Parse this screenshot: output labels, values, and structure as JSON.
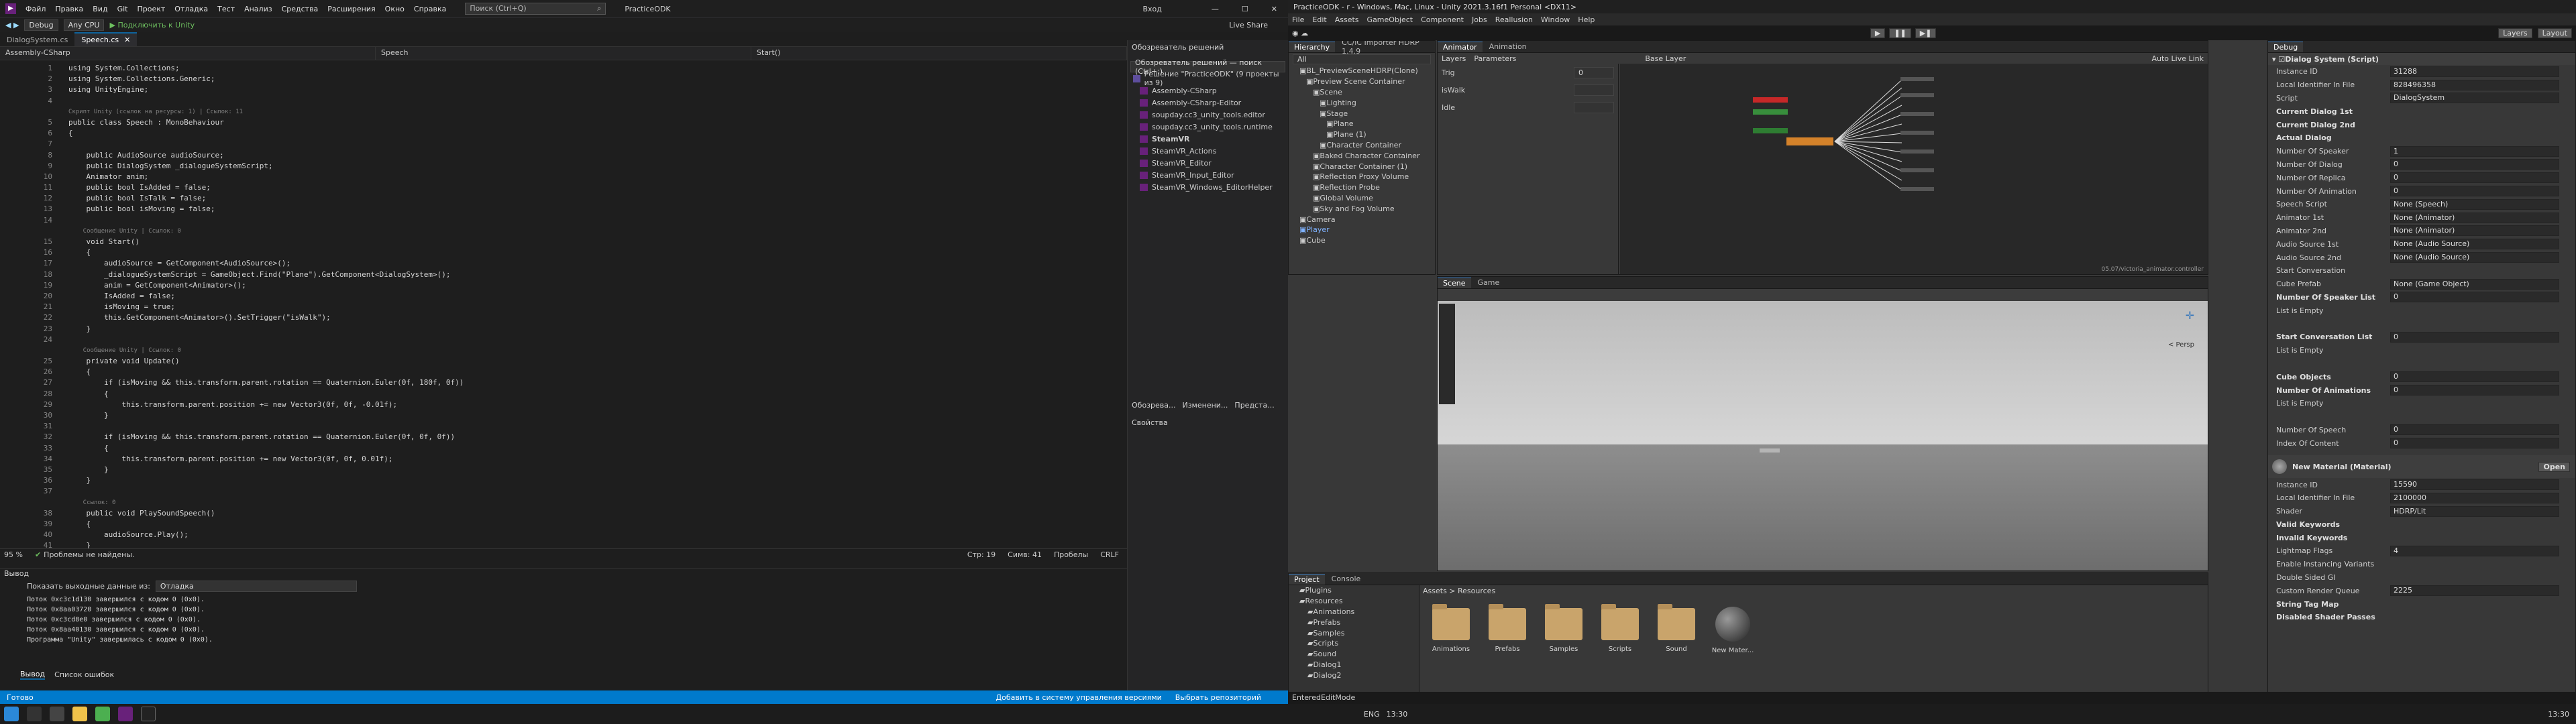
{
  "vs": {
    "title": "PracticeODK",
    "menu": [
      "Файл",
      "Правка",
      "Вид",
      "Git",
      "Проект",
      "Отладка",
      "Тест",
      "Анализ",
      "Средства",
      "Расширения",
      "Окно",
      "Справка"
    ],
    "search_placeholder": "Поиск (Ctrl+Q)",
    "config": "Debug",
    "platform": "Any CPU",
    "attach": "Подключить к Unity",
    "user": "Вход",
    "live_share": "Live Share",
    "tabs": [
      "DialogSystem.cs",
      "Speech.cs"
    ],
    "nav": [
      "Assembly-CSharp",
      "Speech",
      "Start()"
    ],
    "status": {
      "zoom": "95 %",
      "problems": "Проблемы не найдены.",
      "line": "Стр: 19",
      "col": "Симв: 41",
      "spaces": "Пробелы",
      "eol": "CRLF"
    },
    "output_title": "Вывод",
    "output_source_label": "Показать выходные данные из:",
    "output_source": "Отладка",
    "output_lines": [
      "Поток 0xc3c1d130 завершился с кодом 0 (0x0).",
      "Поток 0x8aa03720 завершился с кодом 0 (0x0).",
      "Поток 0xc3cd8e0 завершился с кодом 0 (0x0).",
      "Поток 0x8aa40130 завершился с кодом 0 (0x0).",
      "Программа \"Unity\" завершилась с кодом 0 (0x0)."
    ],
    "bottom_tabs": [
      "Вывод",
      "Список ошибок"
    ],
    "ready": "Готово",
    "add_vcs": "Добавить в систему управления версиями",
    "select_repo": "Выбрать репозиторий",
    "solution_title": "Обозреватель решений",
    "solution_search": "Обозреватель решений — поиск (Ctrl+;)",
    "solution_root": "Решение \"PracticeODK\" (9 проекты из 9)",
    "solution_items": [
      "Assembly-CSharp",
      "Assembly-CSharp-Editor",
      "soupday.cc3_unity_tools.editor",
      "soupday.cc3_unity_tools.runtime",
      "SteamVR",
      "SteamVR_Actions",
      "SteamVR_Editor",
      "SteamVR_Input_Editor",
      "SteamVR_Windows_EditorHelper"
    ],
    "sol_tabs": [
      "Обозрева...",
      "Изменени...",
      "Предста..."
    ],
    "props_title": "Свойства",
    "side_tabs": [
      "Источники данных"
    ]
  },
  "code": [
    {
      "n": "1",
      "t": "using System.Collections;"
    },
    {
      "n": "2",
      "t": "using System.Collections.Generic;"
    },
    {
      "n": "3",
      "t": "using UnityEngine;"
    },
    {
      "n": "4",
      "t": ""
    },
    {
      "n": "",
      "t": "Скрипт Unity (ссылок на ресурсы: 1) | Ссылок: 11",
      "c": true
    },
    {
      "n": "5",
      "t": "public class Speech : MonoBehaviour"
    },
    {
      "n": "6",
      "t": "{"
    },
    {
      "n": "7",
      "t": ""
    },
    {
      "n": "8",
      "t": "    public AudioSource audioSource;"
    },
    {
      "n": "9",
      "t": "    public DialogSystem _dialogueSystemScript;"
    },
    {
      "n": "10",
      "t": "    Animator anim;"
    },
    {
      "n": "11",
      "t": "    public bool IsAdded = false;"
    },
    {
      "n": "12",
      "t": "    public bool IsTalk = false;"
    },
    {
      "n": "13",
      "t": "    public bool isMoving = false;"
    },
    {
      "n": "14",
      "t": ""
    },
    {
      "n": "",
      "t": "    Сообщение Unity | Ссылок: 0",
      "c": true
    },
    {
      "n": "15",
      "t": "    void Start()"
    },
    {
      "n": "16",
      "t": "    {"
    },
    {
      "n": "17",
      "t": "        audioSource = GetComponent<AudioSource>();"
    },
    {
      "n": "18",
      "t": "        _dialogueSystemScript = GameObject.Find(\"Plane\").GetComponent<DialogSystem>();"
    },
    {
      "n": "19",
      "t": "        anim = GetComponent<Animator>();"
    },
    {
      "n": "20",
      "t": "        IsAdded = false;"
    },
    {
      "n": "21",
      "t": "        isMoving = true;"
    },
    {
      "n": "22",
      "t": "        this.GetComponent<Animator>().SetTrigger(\"isWalk\");"
    },
    {
      "n": "23",
      "t": "    }"
    },
    {
      "n": "24",
      "t": ""
    },
    {
      "n": "",
      "t": "    Сообщение Unity | Ссылок: 0",
      "c": true
    },
    {
      "n": "25",
      "t": "    private void Update()"
    },
    {
      "n": "26",
      "t": "    {"
    },
    {
      "n": "27",
      "t": "        if (isMoving && this.transform.parent.rotation == Quaternion.Euler(0f, 180f, 0f))"
    },
    {
      "n": "28",
      "t": "        {"
    },
    {
      "n": "29",
      "t": "            this.transform.parent.position += new Vector3(0f, 0f, -0.01f);"
    },
    {
      "n": "30",
      "t": "        }"
    },
    {
      "n": "31",
      "t": ""
    },
    {
      "n": "32",
      "t": "        if (isMoving && this.transform.parent.rotation == Quaternion.Euler(0f, 0f, 0f))"
    },
    {
      "n": "33",
      "t": "        {"
    },
    {
      "n": "34",
      "t": "            this.transform.parent.position += new Vector3(0f, 0f, 0.01f);"
    },
    {
      "n": "35",
      "t": "        }"
    },
    {
      "n": "36",
      "t": "    }"
    },
    {
      "n": "37",
      "t": ""
    },
    {
      "n": "",
      "t": "    Ссылок: 0",
      "c": true
    },
    {
      "n": "38",
      "t": "    public void PlaySoundSpeech()"
    },
    {
      "n": "39",
      "t": "    {"
    },
    {
      "n": "40",
      "t": "        audioSource.Play();"
    },
    {
      "n": "41",
      "t": "    }"
    }
  ],
  "unity": {
    "title": "PracticeODK - r - Windows, Mac, Linux - Unity 2021.3.16f1 Personal <DX11>",
    "menu": [
      "File",
      "Edit",
      "Assets",
      "GameObject",
      "Component",
      "Jobs",
      "Reallusion",
      "Window",
      "Help"
    ],
    "layers": "Layers",
    "layout": "Layout",
    "hier_tabs": [
      "Hierarchy",
      "CC/iC Importer HDRP 1.4.9"
    ],
    "hier_search": "All",
    "hier_items": [
      {
        "t": "BL_PreviewSceneHDRP(Clone)",
        "d": 1
      },
      {
        "t": "Preview Scene Container",
        "d": 2
      },
      {
        "t": "Scene",
        "d": 3
      },
      {
        "t": "Lighting",
        "d": 4
      },
      {
        "t": "Stage",
        "d": 4
      },
      {
        "t": "Plane",
        "d": 5
      },
      {
        "t": "Plane (1)",
        "d": 5
      },
      {
        "t": "Character Container",
        "d": 4
      },
      {
        "t": "Baked Character Container",
        "d": 3
      },
      {
        "t": "Character Container (1)",
        "d": 3
      },
      {
        "t": "Reflection Proxy Volume",
        "d": 3
      },
      {
        "t": "Reflection Probe",
        "d": 3
      },
      {
        "t": "Global Volume",
        "d": 3
      },
      {
        "t": "Sky and Fog Volume",
        "d": 3
      },
      {
        "t": "Camera",
        "d": 1
      },
      {
        "t": "Player",
        "d": 1
      },
      {
        "t": "Cube",
        "d": 1
      }
    ],
    "anim_tabs": [
      "Animator",
      "Animation"
    ],
    "anim_sub": [
      "Layers",
      "Parameters"
    ],
    "base_layer": "Base Layer",
    "auto_live": "Auto Live Link",
    "params": [
      {
        "n": "Trig",
        "v": "0"
      },
      {
        "n": "isWalk",
        "v": ""
      },
      {
        "n": "Idle",
        "v": ""
      }
    ],
    "anim_path": "05.07/victoria_animator.controller",
    "scene_tabs": [
      "Scene",
      "Game"
    ],
    "persp": "< Persp",
    "insp_tab": "Debug",
    "component": "Dialog System (Script)",
    "insp_rows": [
      {
        "l": "Instance ID",
        "v": "31288"
      },
      {
        "l": "Local Identifier In File",
        "v": "828496358"
      },
      {
        "l": "Script",
        "v": "DialogSystem"
      },
      {
        "l": "Current Dialog 1st",
        "v": "",
        "s": true
      },
      {
        "l": "Current Dialog 2nd",
        "v": "",
        "s": true
      },
      {
        "l": "Actual Dialog",
        "v": "",
        "s": true
      },
      {
        "l": "Number Of Speaker",
        "v": "1"
      },
      {
        "l": "Number Of Dialog",
        "v": "0"
      },
      {
        "l": "Number Of Replica",
        "v": "0"
      },
      {
        "l": "Number Of Animation",
        "v": "0"
      },
      {
        "l": "Speech Script",
        "v": "None (Speech)"
      },
      {
        "l": "Animator 1st",
        "v": "None (Animator)"
      },
      {
        "l": "Animator 2nd",
        "v": "None (Animator)"
      },
      {
        "l": "Audio Source 1st",
        "v": "None (Audio Source)"
      },
      {
        "l": "Audio Source 2nd",
        "v": "None (Audio Source)"
      },
      {
        "l": "Start Conversation",
        "v": ""
      },
      {
        "l": "Cube Prefab",
        "v": "None (Game Object)"
      },
      {
        "l": "Number Of Speaker List",
        "v": "0",
        "s": true
      },
      {
        "l": "List is Empty",
        "v": ""
      },
      {
        "l": "",
        "v": ""
      },
      {
        "l": "Start Conversation List",
        "v": "0",
        "s": true
      },
      {
        "l": "List is Empty",
        "v": ""
      },
      {
        "l": "",
        "v": ""
      },
      {
        "l": "Cube Objects",
        "v": "0",
        "s": true
      },
      {
        "l": "Number Of Animations",
        "v": "0",
        "s": true
      },
      {
        "l": "List is Empty",
        "v": ""
      },
      {
        "l": "",
        "v": ""
      },
      {
        "l": "Number Of Speech",
        "v": "0"
      },
      {
        "l": "Index Of Content",
        "v": "0"
      }
    ],
    "material": "New Material (Material)",
    "open": "Open",
    "mat_rows": [
      {
        "l": "Instance ID",
        "v": "15590"
      },
      {
        "l": "Local Identifier In File",
        "v": "2100000"
      },
      {
        "l": "Shader",
        "v": "HDRP/Lit"
      },
      {
        "l": "Valid Keywords",
        "v": "",
        "s": true
      },
      {
        "l": "Invalid Keywords",
        "v": "",
        "s": true
      },
      {
        "l": "Lightmap Flags",
        "v": "4"
      },
      {
        "l": "Enable Instancing Variants",
        "v": ""
      },
      {
        "l": "Double Sided GI",
        "v": ""
      },
      {
        "l": "Custom Render Queue",
        "v": "2225"
      },
      {
        "l": "String Tag Map",
        "v": "",
        "s": true
      },
      {
        "l": "Disabled Shader Passes",
        "v": "",
        "s": true
      }
    ],
    "proj_tabs": [
      "Project",
      "Console"
    ],
    "breadcrumb": "Assets > Resources",
    "proj_tree": [
      "Plugins",
      "Resources",
      "Animations",
      "Prefabs",
      "Samples",
      "Scripts",
      "Sound",
      "Dialog1",
      "Dialog2"
    ],
    "assets": [
      "Animations",
      "Prefabs",
      "Samples",
      "Scripts",
      "Sound",
      "New Mater..."
    ],
    "status": "EnteredEditMode"
  },
  "taskbar": {
    "lang": "ENG",
    "time": "13:30",
    "time2": "13:30"
  }
}
